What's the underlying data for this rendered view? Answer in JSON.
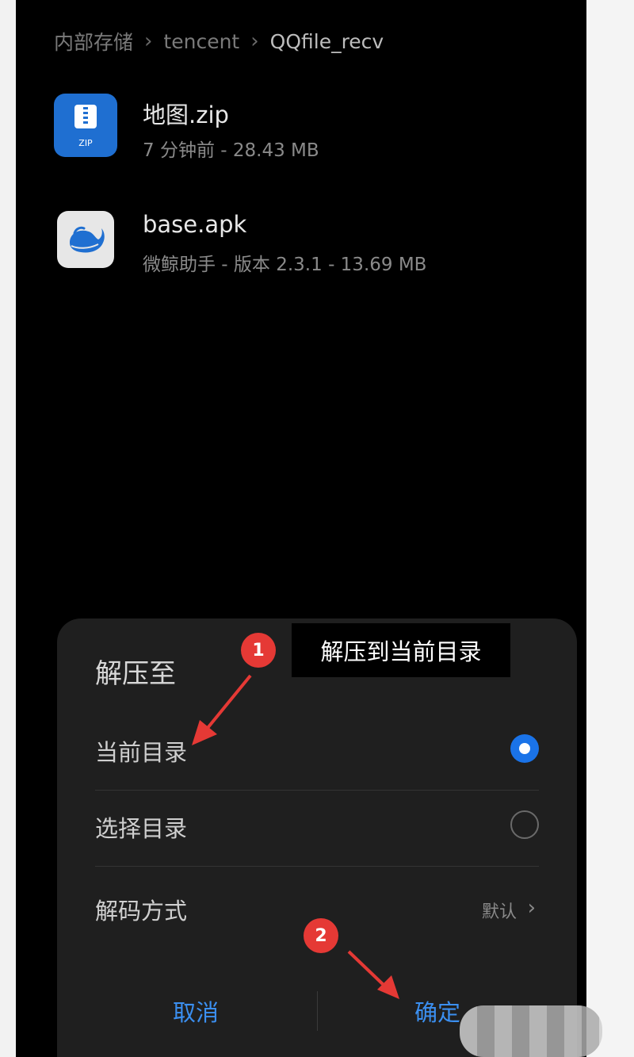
{
  "breadcrumb": {
    "root": "内部存储",
    "folder": "tencent",
    "current": "QQfile_recv"
  },
  "files": [
    {
      "name": "地图.zip",
      "meta": "7 分钟前 - 28.43 MB",
      "icon": "zip-file-icon",
      "icon_label": "ZIP",
      "icon_color": "#1f6fd1"
    },
    {
      "name": "base.apk",
      "meta": "微鲸助手 - 版本 2.3.1 - 13.69 MB",
      "icon": "whale-app-icon"
    }
  ],
  "extract_dialog": {
    "title": "解压至",
    "options": [
      {
        "label": "当前目录",
        "selected": true
      },
      {
        "label": "选择目录",
        "selected": false
      }
    ],
    "decode": {
      "label": "解码方式",
      "value": "默认"
    },
    "cancel_label": "取消",
    "confirm_label": "确定",
    "accent_color": "#1a73e8"
  },
  "annotations": {
    "callout_text": "解压到当前目录",
    "step1": "1",
    "step2": "2",
    "marker_color": "#e53935"
  }
}
